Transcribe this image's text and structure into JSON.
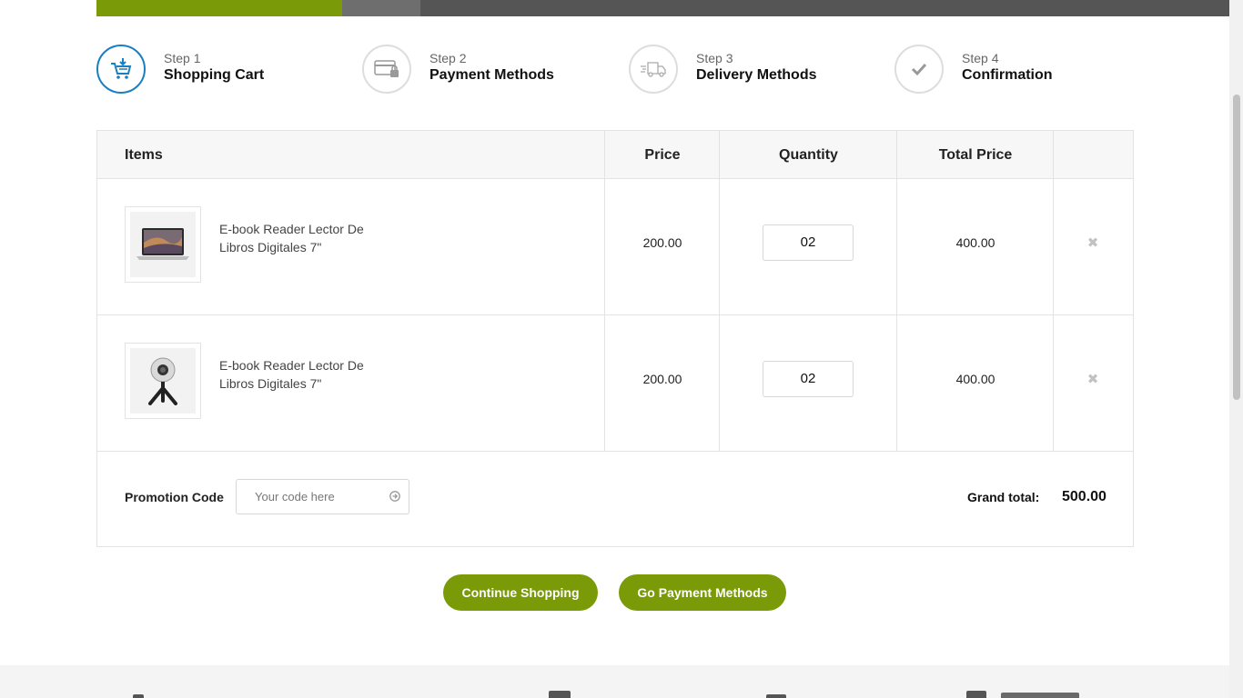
{
  "steps": [
    {
      "number": "Step 1",
      "title": "Shopping Cart",
      "icon": "cart-icon",
      "active": true
    },
    {
      "number": "Step 2",
      "title": "Payment Methods",
      "icon": "credit-card-icon",
      "active": false
    },
    {
      "number": "Step 3",
      "title": "Delivery Methods",
      "icon": "truck-icon",
      "active": false
    },
    {
      "number": "Step 4",
      "title": "Confirmation",
      "icon": "checkmark-icon",
      "active": false
    }
  ],
  "table": {
    "headers": {
      "items": "Items",
      "price": "Price",
      "quantity": "Quantity",
      "total": "Total Price"
    },
    "rows": [
      {
        "image": "laptop",
        "name": "E-book Reader Lector De Libros Digitales 7\"",
        "price": "200.00",
        "quantity": "02",
        "total": "400.00"
      },
      {
        "image": "camera",
        "name": "E-book Reader Lector De Libros Digitales 7\"",
        "price": "200.00",
        "quantity": "02",
        "total": "400.00"
      }
    ]
  },
  "promo": {
    "label": "Promotion Code",
    "placeholder": "Your code here"
  },
  "totals": {
    "grand_label": "Grand total:",
    "grand_value": "500.00"
  },
  "buttons": {
    "continue": "Continue Shopping",
    "next": "Go Payment Methods"
  },
  "colors": {
    "accent": "#7a9a07",
    "active_step": "#1a7fc1"
  }
}
